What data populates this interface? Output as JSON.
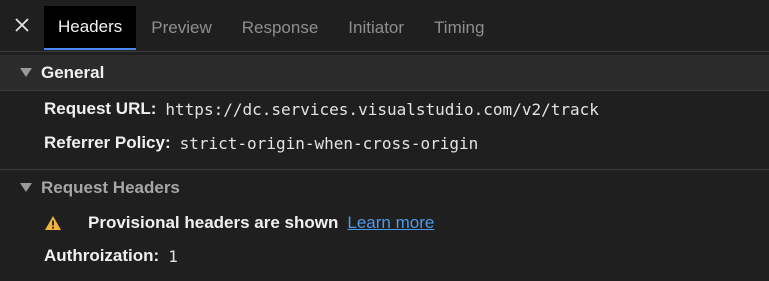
{
  "tabs": [
    {
      "label": "Headers",
      "active": true
    },
    {
      "label": "Preview",
      "active": false
    },
    {
      "label": "Response",
      "active": false
    },
    {
      "label": "Initiator",
      "active": false
    },
    {
      "label": "Timing",
      "active": false
    }
  ],
  "icons": {
    "close": "close-icon",
    "expand": "triangle-down-icon",
    "warning": "warning-icon"
  },
  "colors": {
    "accent": "#4c8bf5",
    "link": "#4d9ae8",
    "warning": "#f2b33d"
  },
  "general": {
    "title": "General",
    "rows": [
      {
        "key": "Request URL:",
        "value": "https://dc.services.visualstudio.com/v2/track"
      },
      {
        "key": "Referrer Policy:",
        "value": "strict-origin-when-cross-origin"
      }
    ]
  },
  "request_headers": {
    "title": "Request Headers",
    "warning_text": "Provisional headers are shown",
    "learn_more_label": "Learn more",
    "rows": [
      {
        "key": "Authroization:",
        "value": "1"
      }
    ]
  }
}
